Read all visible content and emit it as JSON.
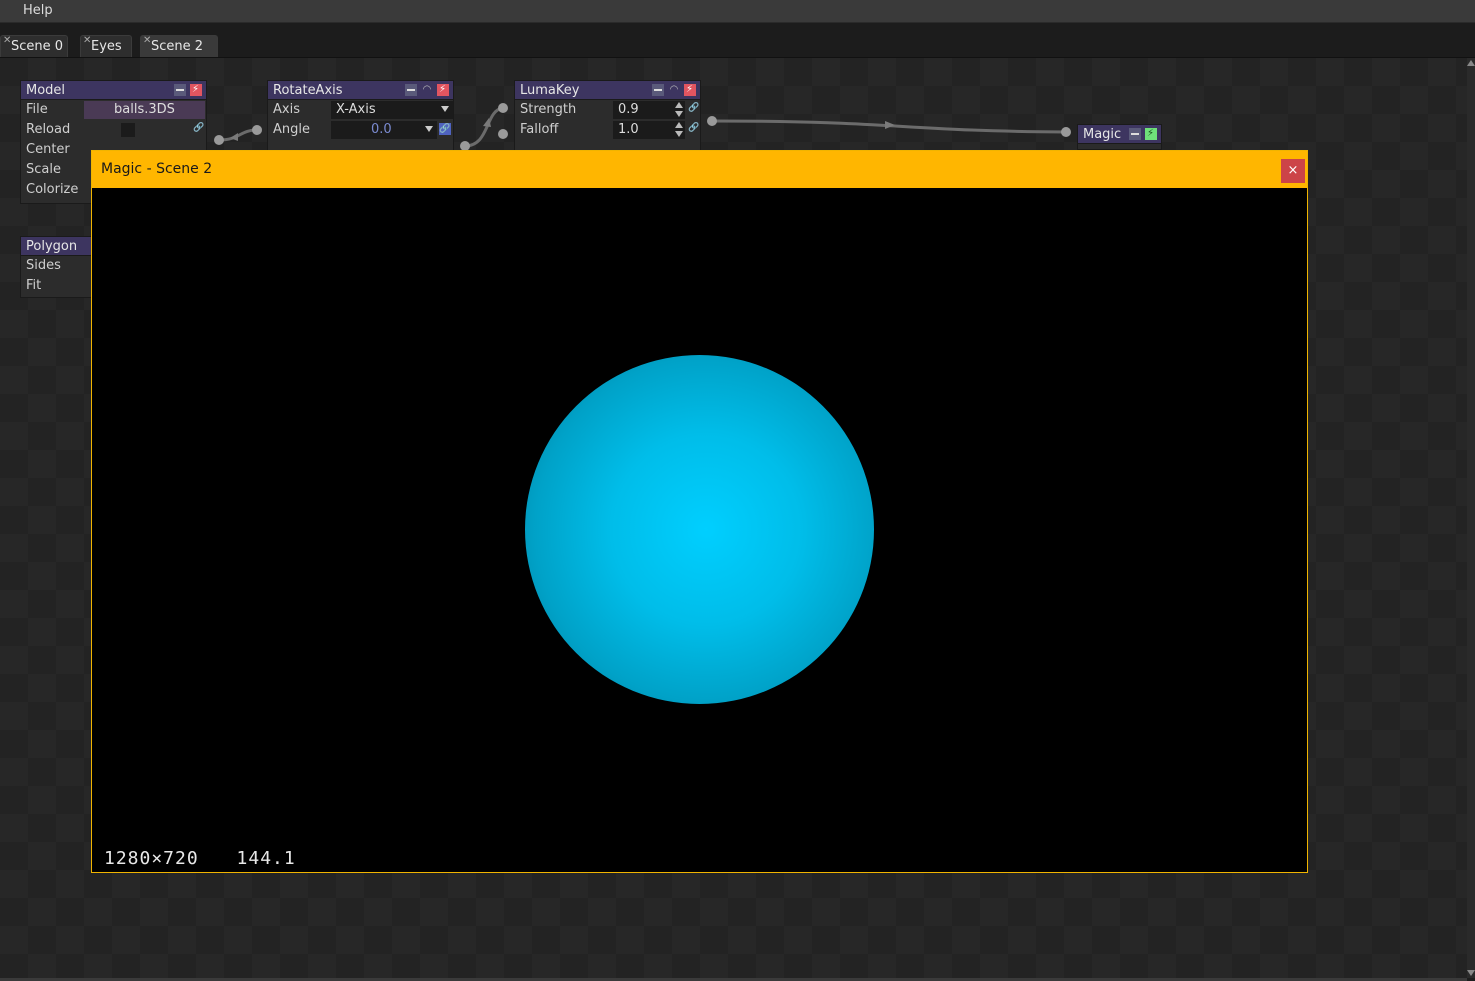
{
  "menubar": {
    "items": [
      "Help"
    ]
  },
  "tabs": [
    {
      "label": "Scene 0",
      "active": false
    },
    {
      "label": "Eyes",
      "active": false
    },
    {
      "label": "Scene 2",
      "active": true
    }
  ],
  "nodes": {
    "model": {
      "title": "Model",
      "rows": [
        "File",
        "Reload",
        "Center",
        "Scale",
        "Colorize"
      ],
      "file_value": "balls.3DS"
    },
    "polygon": {
      "title": "Polygon",
      "rows": [
        "Sides",
        "Fit"
      ]
    },
    "rotate_axis": {
      "title": "RotateAxis",
      "rows": [
        "Axis",
        "Angle"
      ],
      "axis_value": "X-Axis",
      "angle_value": "0.0"
    },
    "luma_key": {
      "title": "LumaKey",
      "rows": [
        "Strength",
        "Falloff"
      ],
      "strength_value": "0.9",
      "falloff_value": "1.0"
    },
    "magic": {
      "title": "Magic"
    }
  },
  "viewer": {
    "title": "Magic - Scene 2",
    "close_label": "×",
    "resolution": "1280×720",
    "fps": "144.1",
    "sphere_color": "#00c8f5"
  },
  "colors": {
    "accent": "#ffb600",
    "node_header": "#3d3560",
    "close_button": "#cc4448"
  }
}
